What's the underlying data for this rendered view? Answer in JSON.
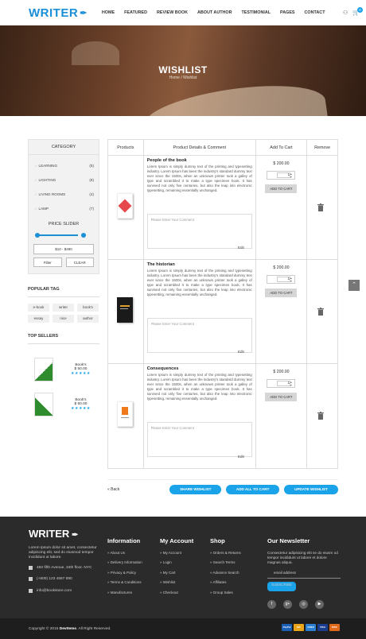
{
  "header": {
    "logo": "WRITER",
    "nav": [
      "HOME",
      "FEATURED",
      "REVIEW BOOK",
      "ABOUT AUTHOR",
      "TESTIMONIAL",
      "PAGES",
      "CONTACT"
    ],
    "cart_count": "0"
  },
  "banner": {
    "title": "WISHLIST",
    "breadcrumb": "Home / Wishlist"
  },
  "sidebar": {
    "category_title": "CATEGORY",
    "categories": [
      {
        "label": "LEARNING",
        "count": "(5)"
      },
      {
        "label": "LIGHTING",
        "count": "(8)"
      },
      {
        "label": "LIVING ROOMS",
        "count": "(4)"
      },
      {
        "label": "LAMP",
        "count": "(7)"
      }
    ],
    "price_slider_title": "PRICE SLIDER",
    "price_range": "$10 - $490",
    "filter_label": "Filter",
    "clear_label": "CLEAR",
    "popular_tag_title": "POPULAR TAG",
    "tags": [
      "e-book",
      "writer",
      "book's",
      "essay",
      "nice",
      "author"
    ],
    "top_sellers_title": "TOP SELLERS",
    "sellers": [
      {
        "name": "Book's",
        "price": "$ 50.00",
        "stars": "★★★★★"
      },
      {
        "name": "Book's",
        "price": "$ 50.00",
        "stars": "★★★★★"
      }
    ]
  },
  "table": {
    "headers": [
      "Products",
      "Product Details & Comment",
      "Add To Cart",
      "Remove"
    ],
    "rows": [
      {
        "name": "People of the book",
        "price": "$ 200.00",
        "qty": "1",
        "edit": "Edit",
        "add_to_cart": "ADD TO CART",
        "cover_color": "#e5484d"
      },
      {
        "name": "The historian",
        "price": "$ 200.00",
        "qty": "1",
        "edit": "Edit",
        "add_to_cart": "ADD TO CART",
        "cover_color": "#1a1a1a"
      },
      {
        "name": "Consequences",
        "price": "$ 200.00",
        "qty": "1",
        "edit": "Edit",
        "add_to_cart": "ADD TO CART",
        "cover_color": "#f07a1a"
      }
    ],
    "description": "Lorem Ipsum is simply dummy text of the printing and typesetting industry. Lorem Ipsum has been the industry's standard dummy text ever since the 1500s, when an unknown printer took a galley of type and scrambled it to make a type specimen book. It has survived not only five centuries, but also the leap into electronic typesetting, remaining essentially unchanged.",
    "comment_placeholder": "Please Enter Your Comment"
  },
  "actions": {
    "back": "« Back",
    "share": "SHARE WISHLIST",
    "add_all": "ADD ALL TO CART",
    "update": "UPDATE WISHLIST"
  },
  "footer": {
    "logo": "WRITER",
    "about": "Lorem Ipsum dolor sit amet, consectetur adipiscing elit, sed do eiusmod tempor incididunt ut labore.",
    "address": "450 fifth Avenue, 34th floor. NYC",
    "phone": "(+800) 123 4567 890",
    "email": "info@bookstore.com",
    "information_title": "Information",
    "information": [
      "About Us",
      "Delivery Information",
      "Privacy & Policy",
      "Terms & Conditions",
      "Manufactures"
    ],
    "account_title": "My Account",
    "account": [
      "My Account",
      "Login",
      "My Cart",
      "Wishlist",
      "Checkout"
    ],
    "shop_title": "Shop",
    "shop": [
      "Orders & Returns",
      "Search Terms",
      "Advance Search",
      "Affiliates",
      "Group Sales"
    ],
    "newsletter_title": "Our Newsletter",
    "newsletter_text": "Consectetur adipisicing elit se do eiusm od tempor incididunt ut labore et dolore magnas aliqua.",
    "email_placeholder": "email address",
    "subscribe": "SUBSCRIBE",
    "social": [
      "f",
      "g+",
      "◎",
      "▶"
    ],
    "copyright_prefix": "Copyright © 2015",
    "copyright_brand": "DevItems",
    "copyright_suffix": ". All Right Reserved.",
    "payments": [
      "PayPal",
      "MC",
      "AMEX",
      "VISA",
      "DISC"
    ]
  },
  "colors": {
    "accent": "#1aa3e8",
    "footer_bg": "#2b2b2b"
  }
}
